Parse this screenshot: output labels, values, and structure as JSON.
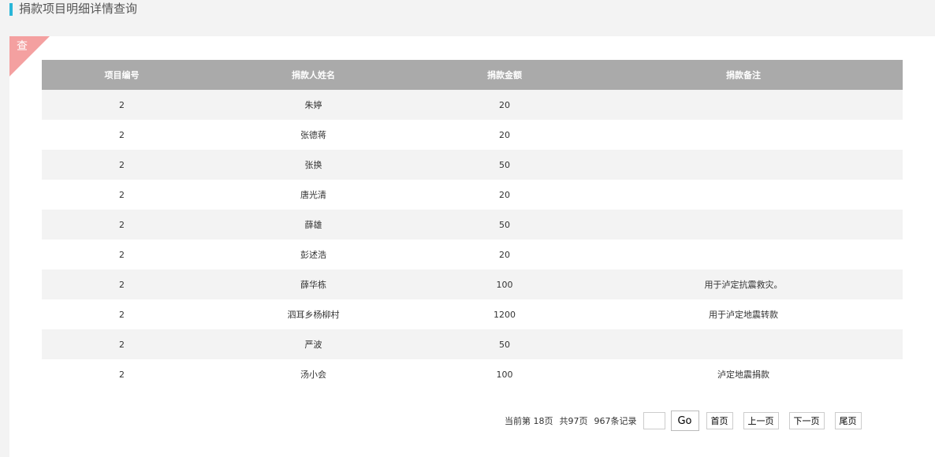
{
  "header": {
    "title": "捐款项目明细详情查询"
  },
  "panel": {
    "corner_label": "查"
  },
  "table": {
    "columns": [
      "项目编号",
      "捐款人姓名",
      "捐款金额",
      "捐款备注"
    ],
    "rows": [
      [
        "2",
        "朱婷",
        "20",
        ""
      ],
      [
        "2",
        "张德蒋",
        "20",
        ""
      ],
      [
        "2",
        "张换",
        "50",
        ""
      ],
      [
        "2",
        "唐光清",
        "20",
        ""
      ],
      [
        "2",
        "薛雄",
        "50",
        ""
      ],
      [
        "2",
        "彭述浩",
        "20",
        ""
      ],
      [
        "2",
        "薛华栋",
        "100",
        "用于泸定抗震救灾。"
      ],
      [
        "2",
        "泗耳乡杨柳村",
        "1200",
        "用于泸定地震转款"
      ],
      [
        "2",
        "严波",
        "50",
        ""
      ],
      [
        "2",
        "汤小会",
        "100",
        "泸定地震捐款"
      ]
    ]
  },
  "pager": {
    "current_page_text": "当前第  18页",
    "total_pages_text": "共97页",
    "total_records_text": "967条记录",
    "page_input_value": "",
    "go_label": "Go",
    "first_label": "首页",
    "prev_label": "上一页",
    "next_label": "下一页",
    "last_label": "尾页"
  },
  "colors": {
    "accent": "#29b6d8",
    "corner": "#f4a0a0",
    "header_bg": "#aaaaaa"
  }
}
